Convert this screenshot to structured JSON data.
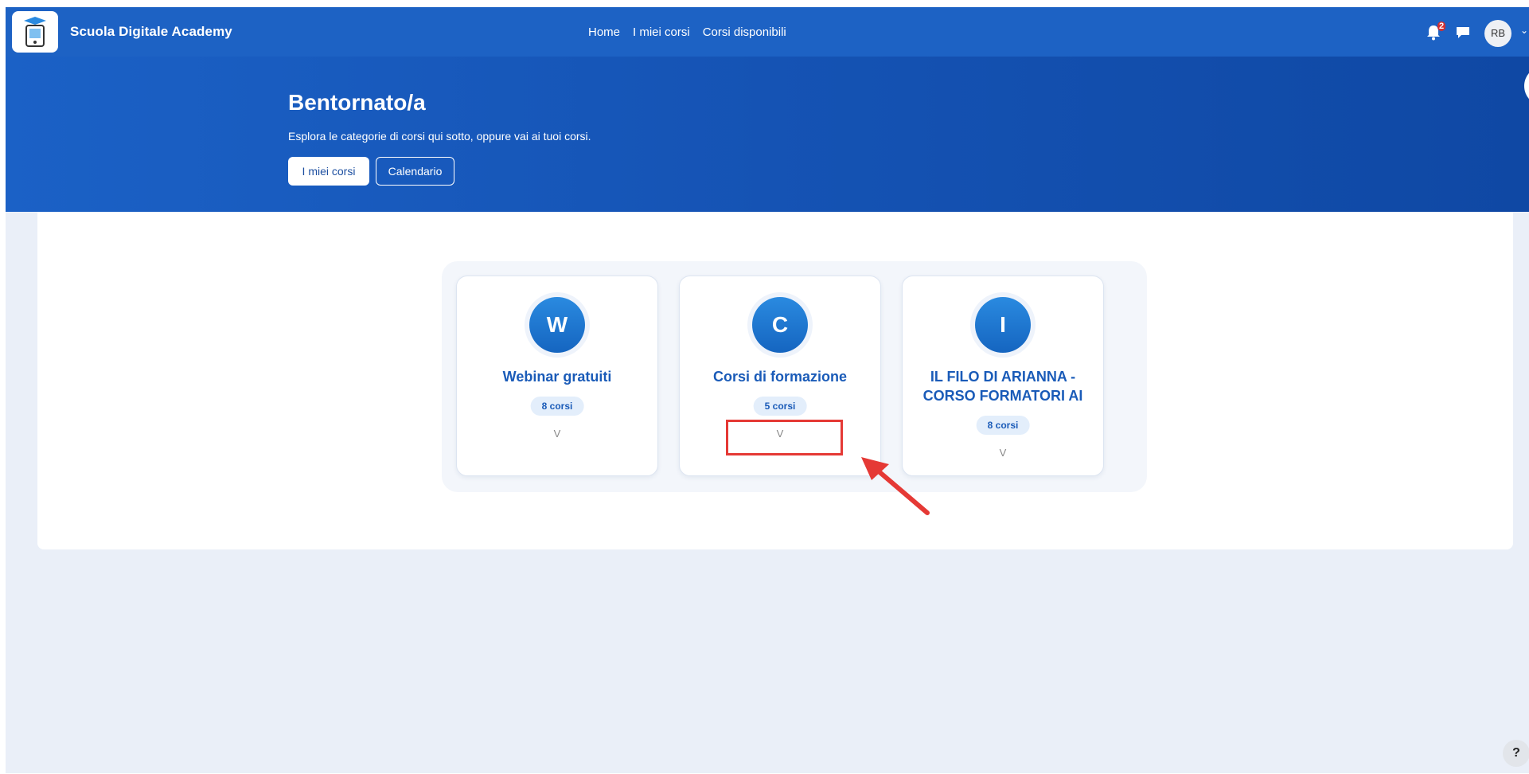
{
  "navbar": {
    "brand": "Scuola Digitale Academy",
    "links": [
      "Home",
      "I miei corsi",
      "Corsi disponibili"
    ],
    "notification_count": "2",
    "avatar_initials": "RB"
  },
  "hero": {
    "title": "Bentornato/a",
    "subtitle": "Esplora le categorie di corsi qui sotto, oppure vai ai tuoi corsi.",
    "primary_button": "I miei corsi",
    "secondary_button": "Calendario"
  },
  "categories": [
    {
      "initial": "W",
      "title": "Webinar gratuiti",
      "count": "8 corsi",
      "toggle": "V"
    },
    {
      "initial": "C",
      "title": "Corsi di formazione",
      "count": "5 corsi",
      "toggle": "V"
    },
    {
      "initial": "I",
      "title": "IL FILO DI ARIANNA - CORSO FORMATORI AI",
      "count": "8 corsi",
      "toggle": "V"
    }
  ],
  "help_label": "?",
  "colors": {
    "navbar": "#1d62c4",
    "accent": "#1a5bb8",
    "annotation": "#e53935"
  }
}
